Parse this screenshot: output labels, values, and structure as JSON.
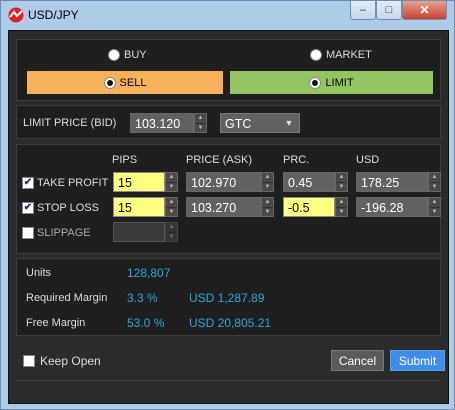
{
  "window": {
    "title": "USD/JPY",
    "minimize": "‒",
    "maximize": "□",
    "close": "✕"
  },
  "direction": {
    "buy_label": "BUY",
    "sell_label": "SELL",
    "selected": "SELL"
  },
  "order_type": {
    "market_label": "MARKET",
    "limit_label": "LIMIT",
    "selected": "LIMIT"
  },
  "limit_price": {
    "label": "LIMIT PRICE (BID)",
    "value": "103.120",
    "tif": "GTC"
  },
  "columns": {
    "pips": "PIPS",
    "price": "PRICE (ASK)",
    "prc": "PRC.",
    "usd": "USD"
  },
  "take_profit": {
    "label": "TAKE PROFIT",
    "checked": true,
    "pips": "15",
    "price": "102.970",
    "prc": "0.45",
    "usd": "178.25"
  },
  "stop_loss": {
    "label": "STOP LOSS",
    "checked": true,
    "pips": "15",
    "price": "103.270",
    "prc": "-0.5",
    "usd": "-196.28"
  },
  "slippage": {
    "label": "SLIPPAGE",
    "checked": false
  },
  "summary": {
    "units_label": "Units",
    "units_value": "128,807",
    "req_margin_label": "Required Margin",
    "req_margin_pct": "3.3 %",
    "req_margin_usd": "USD 1,287.89",
    "free_margin_label": "Free Margin",
    "free_margin_pct": "53.0 %",
    "free_margin_usd": "USD 20,805.21"
  },
  "footer": {
    "keep_open_label": "Keep Open",
    "keep_open_checked": false,
    "cancel_label": "Cancel",
    "submit_label": "Submit"
  },
  "colors": {
    "sell": "#f5b25a",
    "limit": "#93c662",
    "accent": "#2aa6e0",
    "submit": "#3e8ee8",
    "highlight": "#ffff80"
  },
  "icons": {
    "logo": "app-logo-icon",
    "check": "checkmark-icon",
    "spin": "spinner-arrows-icon",
    "dropdown": "chevron-down-icon"
  }
}
